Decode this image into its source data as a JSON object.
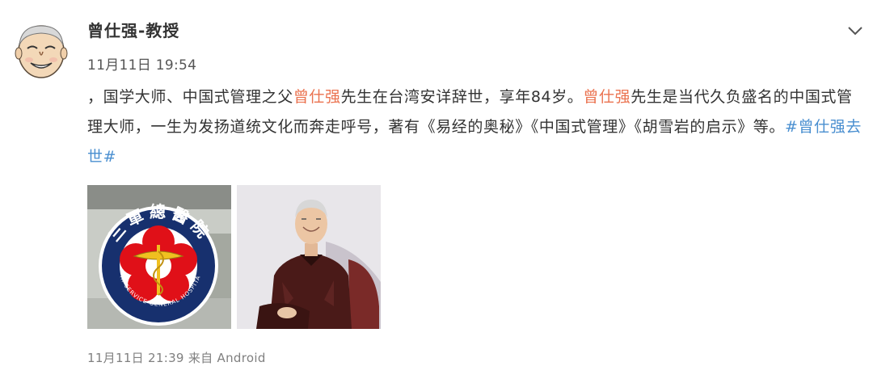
{
  "post": {
    "author": "曾仕强-教授",
    "time": "11月11日 19:54",
    "body": [
      {
        "type": "text",
        "text": "，国学大师、中国式管理之父"
      },
      {
        "type": "mention",
        "text": "曾仕强"
      },
      {
        "type": "text",
        "text": "先生在台湾安详辞世，享年84岁。"
      },
      {
        "type": "mention",
        "text": "曾仕强"
      },
      {
        "type": "text",
        "text": "先生是当代久负盛名的中国式管理大师，一生为发扬道统文化而奔走呼号，著有《易经的奥秘》《中国式管理》《胡雪岩的启示》等。"
      },
      {
        "type": "hashtag",
        "text": "#曾仕强去世#"
      }
    ],
    "images": [
      {
        "name": "hospital-logo-photo",
        "logo_text": "三軍總醫院",
        "logo_subtext": "TRI-SERVICE GENERAL HOSPITAL"
      },
      {
        "name": "portrait-photo"
      }
    ],
    "footer": {
      "time": "11月11日 21:39",
      "source_prefix": "来自",
      "source": "Android"
    }
  },
  "colors": {
    "mention": "#eb7350",
    "hashtag": "#4a8fd0",
    "text": "#333333",
    "meta": "#808080"
  },
  "icons": {
    "avatar": "avatar-icon",
    "more": "chevron-down-icon"
  }
}
